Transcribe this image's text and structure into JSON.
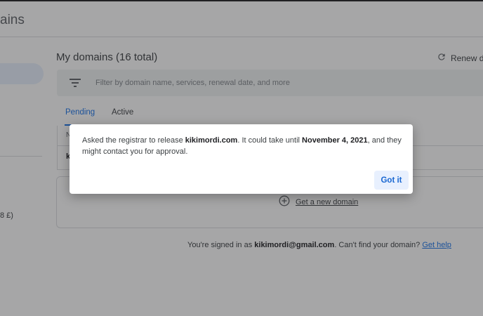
{
  "header": {
    "app_title": "ains"
  },
  "sidebar": {
    "partial_text": "8 £)"
  },
  "main": {
    "title": "My domains (16 total)",
    "renew_label": "Renew do",
    "filter_placeholder": "Filter by domain name, services, renewal date, and more",
    "tabs": [
      {
        "label": "Pending",
        "selected": true
      },
      {
        "label": "Active",
        "selected": false
      }
    ],
    "table": {
      "header_initial": "N",
      "row_initial": "k"
    },
    "get_domain_label": "Get a new domain"
  },
  "footer": {
    "prefix": "You're signed in as ",
    "email": "kikimordi@gmail.com",
    "middle": ". Can't find your domain? ",
    "help_link": "Get help"
  },
  "dialog": {
    "msg_1": "Asked the registrar to release ",
    "domain": "kikimordi.com",
    "msg_2": ". It could take until ",
    "date": "November 4, 2021",
    "msg_3": ", and they might contact you for approval.",
    "button_label": "Got it"
  },
  "colors": {
    "accent": "#1a73e8",
    "overlay": "#202124",
    "button_bg": "#e8f0fe"
  },
  "icons": {
    "filter": "filter-icon",
    "renew": "refresh-icon",
    "add": "add-circle-icon"
  }
}
